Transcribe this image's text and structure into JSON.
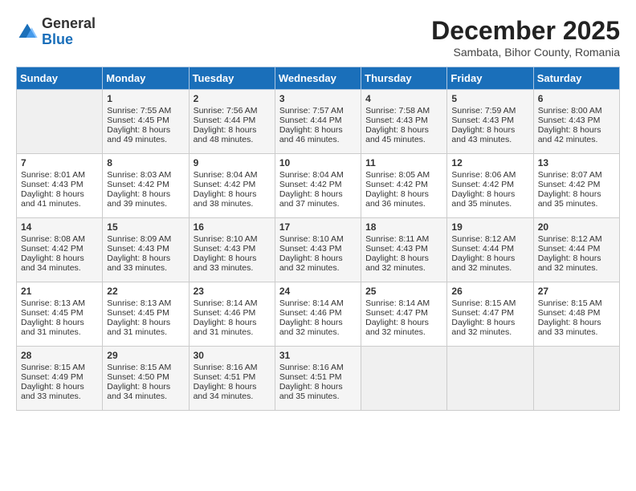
{
  "header": {
    "logo_general": "General",
    "logo_blue": "Blue",
    "month_title": "December 2025",
    "location": "Sambata, Bihor County, Romania"
  },
  "days_of_week": [
    "Sunday",
    "Monday",
    "Tuesday",
    "Wednesday",
    "Thursday",
    "Friday",
    "Saturday"
  ],
  "weeks": [
    [
      {
        "day": "",
        "sunrise": "",
        "sunset": "",
        "daylight": "",
        "empty": true
      },
      {
        "day": "1",
        "sunrise": "Sunrise: 7:55 AM",
        "sunset": "Sunset: 4:45 PM",
        "daylight": "Daylight: 8 hours and 49 minutes."
      },
      {
        "day": "2",
        "sunrise": "Sunrise: 7:56 AM",
        "sunset": "Sunset: 4:44 PM",
        "daylight": "Daylight: 8 hours and 48 minutes."
      },
      {
        "day": "3",
        "sunrise": "Sunrise: 7:57 AM",
        "sunset": "Sunset: 4:44 PM",
        "daylight": "Daylight: 8 hours and 46 minutes."
      },
      {
        "day": "4",
        "sunrise": "Sunrise: 7:58 AM",
        "sunset": "Sunset: 4:43 PM",
        "daylight": "Daylight: 8 hours and 45 minutes."
      },
      {
        "day": "5",
        "sunrise": "Sunrise: 7:59 AM",
        "sunset": "Sunset: 4:43 PM",
        "daylight": "Daylight: 8 hours and 43 minutes."
      },
      {
        "day": "6",
        "sunrise": "Sunrise: 8:00 AM",
        "sunset": "Sunset: 4:43 PM",
        "daylight": "Daylight: 8 hours and 42 minutes."
      }
    ],
    [
      {
        "day": "7",
        "sunrise": "Sunrise: 8:01 AM",
        "sunset": "Sunset: 4:43 PM",
        "daylight": "Daylight: 8 hours and 41 minutes."
      },
      {
        "day": "8",
        "sunrise": "Sunrise: 8:03 AM",
        "sunset": "Sunset: 4:42 PM",
        "daylight": "Daylight: 8 hours and 39 minutes."
      },
      {
        "day": "9",
        "sunrise": "Sunrise: 8:04 AM",
        "sunset": "Sunset: 4:42 PM",
        "daylight": "Daylight: 8 hours and 38 minutes."
      },
      {
        "day": "10",
        "sunrise": "Sunrise: 8:04 AM",
        "sunset": "Sunset: 4:42 PM",
        "daylight": "Daylight: 8 hours and 37 minutes."
      },
      {
        "day": "11",
        "sunrise": "Sunrise: 8:05 AM",
        "sunset": "Sunset: 4:42 PM",
        "daylight": "Daylight: 8 hours and 36 minutes."
      },
      {
        "day": "12",
        "sunrise": "Sunrise: 8:06 AM",
        "sunset": "Sunset: 4:42 PM",
        "daylight": "Daylight: 8 hours and 35 minutes."
      },
      {
        "day": "13",
        "sunrise": "Sunrise: 8:07 AM",
        "sunset": "Sunset: 4:42 PM",
        "daylight": "Daylight: 8 hours and 35 minutes."
      }
    ],
    [
      {
        "day": "14",
        "sunrise": "Sunrise: 8:08 AM",
        "sunset": "Sunset: 4:42 PM",
        "daylight": "Daylight: 8 hours and 34 minutes."
      },
      {
        "day": "15",
        "sunrise": "Sunrise: 8:09 AM",
        "sunset": "Sunset: 4:43 PM",
        "daylight": "Daylight: 8 hours and 33 minutes."
      },
      {
        "day": "16",
        "sunrise": "Sunrise: 8:10 AM",
        "sunset": "Sunset: 4:43 PM",
        "daylight": "Daylight: 8 hours and 33 minutes."
      },
      {
        "day": "17",
        "sunrise": "Sunrise: 8:10 AM",
        "sunset": "Sunset: 4:43 PM",
        "daylight": "Daylight: 8 hours and 32 minutes."
      },
      {
        "day": "18",
        "sunrise": "Sunrise: 8:11 AM",
        "sunset": "Sunset: 4:43 PM",
        "daylight": "Daylight: 8 hours and 32 minutes."
      },
      {
        "day": "19",
        "sunrise": "Sunrise: 8:12 AM",
        "sunset": "Sunset: 4:44 PM",
        "daylight": "Daylight: 8 hours and 32 minutes."
      },
      {
        "day": "20",
        "sunrise": "Sunrise: 8:12 AM",
        "sunset": "Sunset: 4:44 PM",
        "daylight": "Daylight: 8 hours and 32 minutes."
      }
    ],
    [
      {
        "day": "21",
        "sunrise": "Sunrise: 8:13 AM",
        "sunset": "Sunset: 4:45 PM",
        "daylight": "Daylight: 8 hours and 31 minutes."
      },
      {
        "day": "22",
        "sunrise": "Sunrise: 8:13 AM",
        "sunset": "Sunset: 4:45 PM",
        "daylight": "Daylight: 8 hours and 31 minutes."
      },
      {
        "day": "23",
        "sunrise": "Sunrise: 8:14 AM",
        "sunset": "Sunset: 4:46 PM",
        "daylight": "Daylight: 8 hours and 31 minutes."
      },
      {
        "day": "24",
        "sunrise": "Sunrise: 8:14 AM",
        "sunset": "Sunset: 4:46 PM",
        "daylight": "Daylight: 8 hours and 32 minutes."
      },
      {
        "day": "25",
        "sunrise": "Sunrise: 8:14 AM",
        "sunset": "Sunset: 4:47 PM",
        "daylight": "Daylight: 8 hours and 32 minutes."
      },
      {
        "day": "26",
        "sunrise": "Sunrise: 8:15 AM",
        "sunset": "Sunset: 4:47 PM",
        "daylight": "Daylight: 8 hours and 32 minutes."
      },
      {
        "day": "27",
        "sunrise": "Sunrise: 8:15 AM",
        "sunset": "Sunset: 4:48 PM",
        "daylight": "Daylight: 8 hours and 33 minutes."
      }
    ],
    [
      {
        "day": "28",
        "sunrise": "Sunrise: 8:15 AM",
        "sunset": "Sunset: 4:49 PM",
        "daylight": "Daylight: 8 hours and 33 minutes."
      },
      {
        "day": "29",
        "sunrise": "Sunrise: 8:15 AM",
        "sunset": "Sunset: 4:50 PM",
        "daylight": "Daylight: 8 hours and 34 minutes."
      },
      {
        "day": "30",
        "sunrise": "Sunrise: 8:16 AM",
        "sunset": "Sunset: 4:51 PM",
        "daylight": "Daylight: 8 hours and 34 minutes."
      },
      {
        "day": "31",
        "sunrise": "Sunrise: 8:16 AM",
        "sunset": "Sunset: 4:51 PM",
        "daylight": "Daylight: 8 hours and 35 minutes."
      },
      {
        "day": "",
        "sunrise": "",
        "sunset": "",
        "daylight": "",
        "empty": true
      },
      {
        "day": "",
        "sunrise": "",
        "sunset": "",
        "daylight": "",
        "empty": true
      },
      {
        "day": "",
        "sunrise": "",
        "sunset": "",
        "daylight": "",
        "empty": true
      }
    ]
  ]
}
